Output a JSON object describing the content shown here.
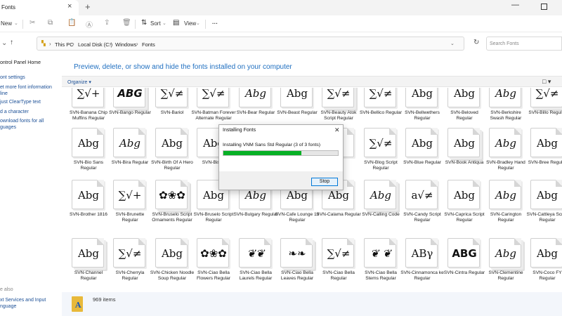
{
  "window": {
    "tab_title": "Fonts",
    "tab_close": "×",
    "new_tab": "+",
    "minimize": "—"
  },
  "toolbar": {
    "new_label": "New",
    "sort_label": "Sort",
    "view_label": "View",
    "more": "···"
  },
  "address": {
    "crumbs": [
      "This PC",
      "Local Disk (C:)",
      "Windows",
      "Fonts"
    ],
    "search_placeholder": "Search Fonts"
  },
  "sidebar": {
    "items": [
      "ontrol Panel Home",
      "ont settings",
      "et more font information",
      "line",
      "just ClearType text",
      "d a character",
      "ownload fonts for all",
      "guages"
    ],
    "see_also": "e also",
    "see_also_items": [
      "xt Services and Input",
      "nguage"
    ]
  },
  "main": {
    "heading": "Preview, delete, or show and hide the fonts installed on your computer",
    "organize": "Organize ▾",
    "view_icon": "□ ▾"
  },
  "fonts": [
    {
      "sample": "∑√+",
      "label": "SVN-Banana Chip Muffins Regular"
    },
    {
      "sample": "ABG",
      "label": "SVN-Bango Regular"
    },
    {
      "sample": "∑√≠",
      "label": "SVN-Bariol"
    },
    {
      "sample": "∑√≠",
      "label": "SVN-Batman Forever Alternate Regular"
    },
    {
      "sample": "Abg",
      "label": "SVN-Bear Regular"
    },
    {
      "sample": "Abg",
      "label": "SVN-Beast Regular"
    },
    {
      "sample": "∑√≠",
      "label": "SVN-Beauty Atok Script Regular"
    },
    {
      "sample": "∑√≠",
      "label": "SVN-Bellico Regular"
    },
    {
      "sample": "Abg",
      "label": "SVN-Bellwethers Regular"
    },
    {
      "sample": "Abg",
      "label": "SVN-Beloved Regular"
    },
    {
      "sample": "Abg",
      "label": "SVN-Berkshire Swash Regular"
    },
    {
      "sample": "∑√≠",
      "label": "SVN-Billo Regular"
    },
    {
      "sample": "Abg",
      "label": "SVN-Bio Sans Regular"
    },
    {
      "sample": "Abg",
      "label": "SVN-Bira Regular"
    },
    {
      "sample": "Abg",
      "label": "SVN-Birth Of A Hero Regular"
    },
    {
      "sample": "Abg",
      "label": "SVN-Bistro"
    },
    {
      "sample": "",
      "label": ""
    },
    {
      "sample": "",
      "label": ""
    },
    {
      "sample": "",
      "label": "ck"
    },
    {
      "sample": "∑√≠",
      "label": "SVN-Blog Script Regular"
    },
    {
      "sample": "Abg",
      "label": "SVN-Blue Regular"
    },
    {
      "sample": "Abg",
      "label": "SVN-Book Antiqua"
    },
    {
      "sample": "Abg",
      "label": "SVN-Bradley Hand Regular"
    },
    {
      "sample": "Abg",
      "label": "SVN-Bree Regular"
    },
    {
      "sample": "Abg",
      "label": "SVN-Brother 1816"
    },
    {
      "sample": "∑√+",
      "label": "SVN-Brunette Regular"
    },
    {
      "sample": "✿❀✿",
      "label": "SVN-Bruselo Script Ornaments Regular"
    },
    {
      "sample": "Abg",
      "label": "SVN-Bruselo Script Regular"
    },
    {
      "sample": "Abg",
      "label": "SVN-Bulgary Regular"
    },
    {
      "sample": "Abg",
      "label": "SVN-Cafe Lounge 19 Regular"
    },
    {
      "sample": "Abg",
      "label": "SVN-Calama Regular"
    },
    {
      "sample": "Abg",
      "label": "SVN-Calling Code"
    },
    {
      "sample": "a√≠",
      "label": "SVN-Candy Script Regular"
    },
    {
      "sample": "Abg",
      "label": "SVN-Caprica Script Regular"
    },
    {
      "sample": "Abg",
      "label": "SVN-Carington Regular"
    },
    {
      "sample": "Abg",
      "label": "SVN-Cattleya Script Regular"
    },
    {
      "sample": "Abg",
      "label": "SVN-Channel Regular"
    },
    {
      "sample": "∑√≠",
      "label": "SVN-Cherryla Regular"
    },
    {
      "sample": "Abg",
      "label": "SVN-Chicken Noodle Soup Regular"
    },
    {
      "sample": "✿❀✿",
      "label": "SVN-Ciao Bella Flowers Regular"
    },
    {
      "sample": "❦❦",
      "label": "SVN-Ciao Bella Laurels Regular"
    },
    {
      "sample": "❧❧",
      "label": "SVN-Ciao Bella Leaves Regular"
    },
    {
      "sample": "∑√≠",
      "label": "SVN-Ciao Bella Regular"
    },
    {
      "sample": "❦ ❦",
      "label": "SVN-Ciao Bella Stems Regular"
    },
    {
      "sample": "ΑΒγ",
      "label": "SVN-Cinnamonca ke Regular"
    },
    {
      "sample": "ABG",
      "label": "SVN-Cintra Regular"
    },
    {
      "sample": "Abg",
      "label": "SVN-Clementine Regular"
    },
    {
      "sample": "Abg",
      "label": "SVN-Coco FY Regular"
    }
  ],
  "status": {
    "count": "969 items"
  },
  "dialog": {
    "title": "Installing Fonts",
    "close": "✕",
    "message": "Installing VNM Sans Std Regular (3 of 3 fonts)",
    "progress": 0.68,
    "stop_label": "Stop"
  }
}
